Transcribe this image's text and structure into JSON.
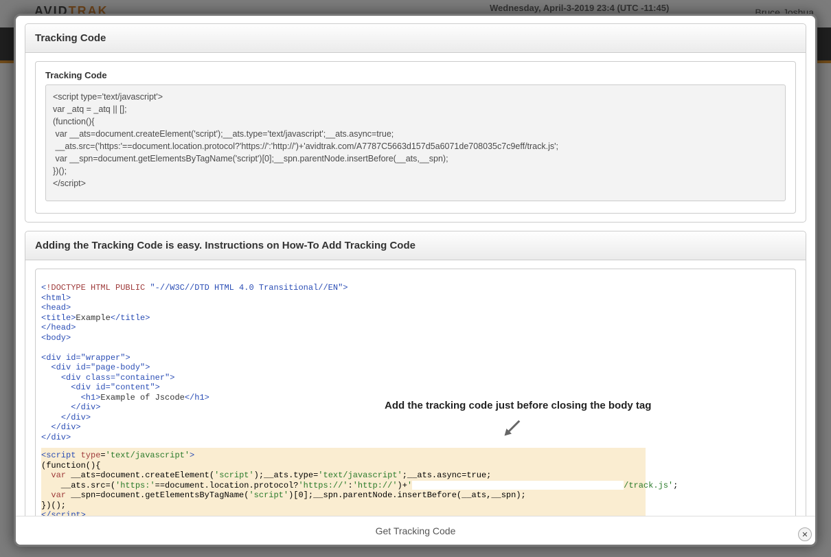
{
  "background": {
    "logo_a": "AVID",
    "logo_b": "TRAK",
    "date": "Wednesday, April-3-2019 23:4 (UTC -11:45)",
    "user": "Bruce Joshua"
  },
  "modal": {
    "footer_text": "Get Tracking Code",
    "close_label": "✕",
    "panel1": {
      "title": "Tracking Code",
      "field_label": "Tracking Code",
      "code": "<script type='text/javascript'>\nvar _atq = _atq || [];\n(function(){\n var __ats=document.createElement('script');__ats.type='text/javascript';__ats.async=true;\n __ats.src=('https:'==document.location.protocol?'https://':'http://')+'avidtrak.com/A7787C5663d157d5a6071de708035c7c9eff/track.js';\n var __spn=document.getElementsByTagName('script')[0];__spn.parentNode.insertBefore(__ats,__spn);\n})();\n</script>"
    },
    "panel2": {
      "title": "Adding the Tracking Code is easy. Instructions on How-To Add Tracking Code",
      "callout": "Add the tracking code just before closing the body tag",
      "example_title_text": "Example",
      "example_h1_text": "Example of Jscode"
    }
  }
}
